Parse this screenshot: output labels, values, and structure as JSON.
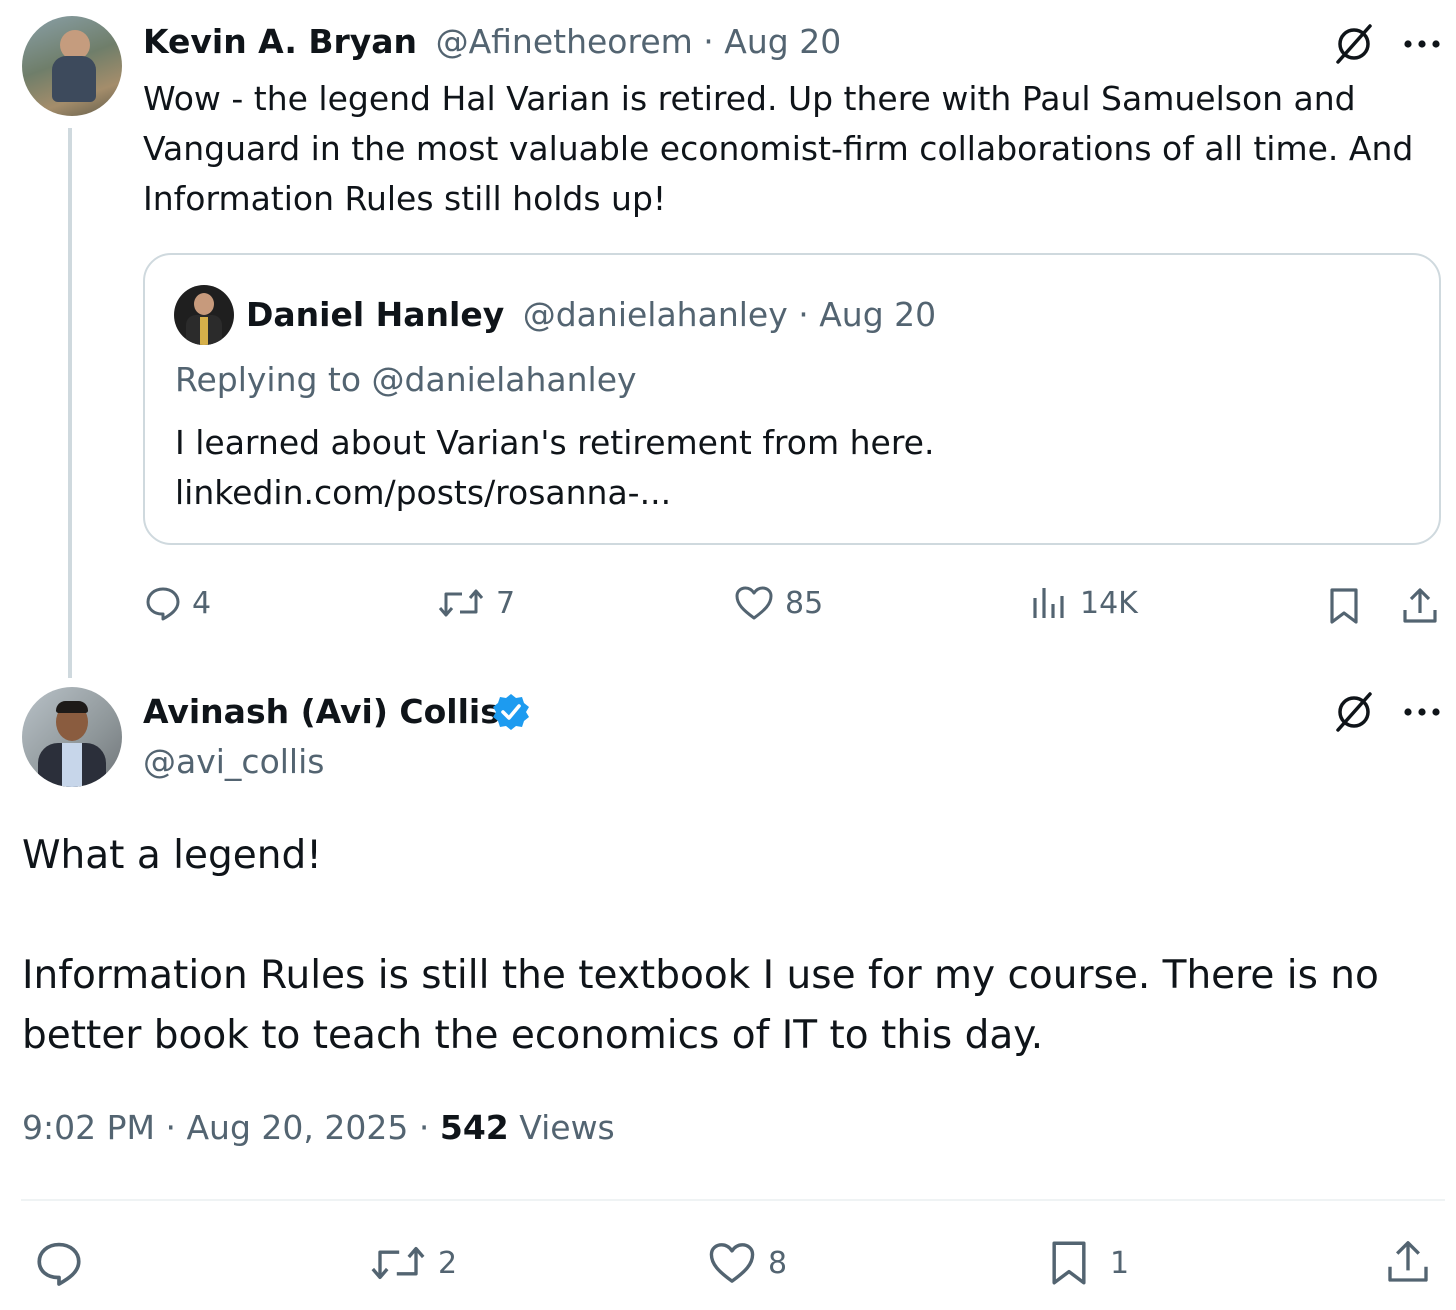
{
  "tweet1": {
    "display_name": "Kevin A. Bryan",
    "handle": "@Afinetheorem",
    "separator": "·",
    "date": "Aug 20",
    "text_lines": [
      "Wow - the legend Hal Varian is retired. Up there with Paul Samuelson and",
      "Vanguard in the most valuable economist-firm collaborations of all time. And",
      "Information Rules still holds up!"
    ],
    "quote": {
      "display_name": "Daniel Hanley",
      "handle": "@danielahanley",
      "separator": "·",
      "date": "Aug 20",
      "replying_label": "Replying to",
      "replying_handle": "@danielahanley",
      "text": "I learned about Varian's retirement from here.",
      "link": "linkedin.com/posts/rosanna-..."
    },
    "stats": {
      "replies": "4",
      "reposts": "7",
      "likes": "85",
      "views": "14K"
    },
    "icons": {
      "grok": "grok-slash-icon",
      "more": "more-dots-icon",
      "reply": "reply-bubble-icon",
      "repost": "repost-icon",
      "like": "heart-icon",
      "views": "bar-chart-icon",
      "bookmark": "bookmark-icon",
      "share": "share-icon"
    }
  },
  "tweet2": {
    "display_name": "Avinash (Avi) Collis",
    "verified": true,
    "handle": "@avi_collis",
    "paragraph1": "What a legend!",
    "paragraph2_lines": [
      "Information Rules is still the textbook I use for my course. There is no",
      "better book to teach the economics of IT to this day."
    ],
    "time": "9:02 PM",
    "separator": "·",
    "date": "Aug 20, 2025",
    "views_count": "542",
    "views_label": "Views",
    "stats": {
      "reposts": "2",
      "likes": "8",
      "bookmarks": "1"
    }
  },
  "colors": {
    "text": "#0f1419",
    "muted": "#536471",
    "border": "#cfd9de",
    "verified": "#1d9bf0"
  }
}
